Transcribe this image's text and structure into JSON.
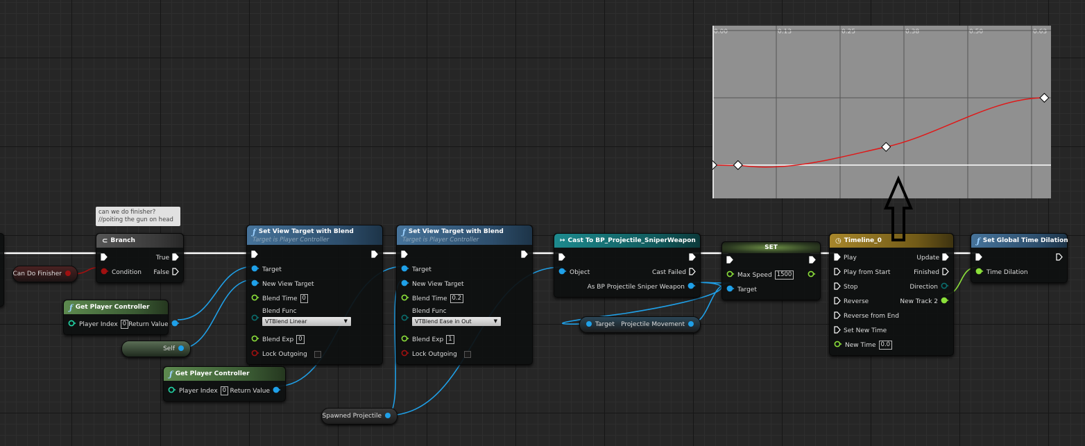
{
  "comment": {
    "lines": [
      "can we do finisher?",
      "//poiting the gun on head"
    ]
  },
  "nodes": [
    {
      "title": "Branch",
      "style": "branch",
      "icon": "branch-icon",
      "rows": [
        {
          "l": {
            "pin": "exec",
            "label": "",
            "connected": true
          },
          "r": {
            "pin": "exec",
            "label": "True",
            "connected": true
          }
        },
        {
          "l": {
            "pin": "bool",
            "label": "Condition",
            "connected": true
          },
          "r": {
            "pin": "exec",
            "label": "False",
            "connected": false
          }
        }
      ]
    },
    {
      "title": "Get Player Controller",
      "style": "pure",
      "icon": "function-icon",
      "rows": [
        {
          "l": {
            "pin": "int",
            "label": "Player Index",
            "value": "0"
          },
          "r": {
            "pin": "object",
            "label": "Return Value",
            "connected": true
          }
        }
      ]
    },
    {
      "title": "Set View Target with Blend",
      "subtitle": "Target is Player Controller",
      "style": "func",
      "icon": "function-icon",
      "rows": [
        {
          "l": {
            "pin": "exec",
            "label": "",
            "connected": true
          },
          "r": {
            "pin": "exec",
            "label": "",
            "connected": true
          }
        },
        {
          "l": {
            "pin": "object",
            "label": "Target",
            "connected": true
          }
        },
        {
          "l": {
            "pin": "object",
            "label": "New View Target",
            "connected": true
          }
        },
        {
          "l": {
            "pin": "float",
            "label": "Blend Time",
            "value": "0"
          }
        },
        {
          "l": {
            "pin": "enum",
            "label": "Blend Func",
            "dropdown": "VTBlend Linear"
          }
        },
        {
          "l": {
            "pin": "float",
            "label": "Blend Exp",
            "value": "0"
          }
        },
        {
          "l": {
            "pin": "bool",
            "label": "Lock Outgoing",
            "checkbox": false
          }
        }
      ]
    },
    {
      "title": "Get Player Controller",
      "style": "pure",
      "icon": "function-icon",
      "rows": [
        {
          "l": {
            "pin": "int",
            "label": "Player Index",
            "value": "0"
          },
          "r": {
            "pin": "object",
            "label": "Return Value",
            "connected": true
          }
        }
      ]
    },
    {
      "title": "Set View Target with Blend",
      "subtitle": "Target is Player Controller",
      "style": "func",
      "icon": "function-icon",
      "rows": [
        {
          "l": {
            "pin": "exec",
            "label": "",
            "connected": true
          },
          "r": {
            "pin": "exec",
            "label": "",
            "connected": true
          }
        },
        {
          "l": {
            "pin": "object",
            "label": "Target",
            "connected": true
          }
        },
        {
          "l": {
            "pin": "object",
            "label": "New View Target",
            "connected": true
          }
        },
        {
          "l": {
            "pin": "float",
            "label": "Blend Time",
            "value": "0.2"
          }
        },
        {
          "l": {
            "pin": "enum",
            "label": "Blend Func",
            "dropdown": "VTBlend Ease in Out"
          }
        },
        {
          "l": {
            "pin": "float",
            "label": "Blend Exp",
            "value": "1"
          }
        },
        {
          "l": {
            "pin": "bool",
            "label": "Lock Outgoing",
            "checkbox": false
          }
        }
      ]
    },
    {
      "title": "Cast To BP_Projectile_SniperWeapon",
      "style": "cast",
      "icon": "cast-icon",
      "rows": [
        {
          "l": {
            "pin": "exec",
            "label": "",
            "connected": true
          },
          "r": {
            "pin": "exec",
            "label": "",
            "connected": true
          }
        },
        {
          "l": {
            "pin": "object",
            "label": "Object",
            "connected": true
          },
          "r": {
            "pin": "exec",
            "label": "Cast Failed",
            "connected": false
          }
        },
        {
          "r": {
            "pin": "object",
            "label": "As BP Projectile Sniper Weapon",
            "connected": true
          }
        }
      ]
    },
    {
      "title": "SET",
      "style": "set",
      "icon": "",
      "rows": [
        {
          "l": {
            "pin": "exec",
            "label": "",
            "connected": true
          },
          "r": {
            "pin": "exec",
            "label": "",
            "connected": true
          }
        },
        {
          "l": {
            "pin": "float",
            "label": "Max Speed",
            "value": "1500"
          },
          "r": {
            "pin": "float",
            "label": ""
          }
        },
        {
          "l": {
            "pin": "object",
            "label": "Target",
            "connected": true
          }
        }
      ]
    },
    {
      "title": "Timeline_0",
      "style": "time",
      "icon": "clock-icon",
      "rows": [
        {
          "l": {
            "pin": "exec",
            "label": "Play",
            "connected": true
          },
          "r": {
            "pin": "exec",
            "label": "Update",
            "connected": true
          }
        },
        {
          "l": {
            "pin": "exec",
            "label": "Play from Start"
          },
          "r": {
            "pin": "exec",
            "label": "Finished"
          }
        },
        {
          "l": {
            "pin": "exec",
            "label": "Stop"
          },
          "r": {
            "pin": "enum",
            "label": "Direction"
          }
        },
        {
          "l": {
            "pin": "exec",
            "label": "Reverse"
          },
          "r": {
            "pin": "float",
            "label": "New Track 2",
            "connected": true
          }
        },
        {
          "l": {
            "pin": "exec",
            "label": "Reverse from End"
          }
        },
        {
          "l": {
            "pin": "exec",
            "label": "Set New Time"
          }
        },
        {
          "l": {
            "pin": "float",
            "label": "New Time",
            "value": "0.0"
          }
        }
      ]
    },
    {
      "title": "Set Global Time Dilation",
      "style": "func",
      "icon": "function-icon",
      "rows": [
        {
          "l": {
            "pin": "exec",
            "label": "",
            "connected": true
          },
          "r": {
            "pin": "exec",
            "label": ""
          }
        },
        {
          "l": {
            "pin": "float",
            "label": "Time Dilation",
            "connected": true
          }
        }
      ]
    }
  ],
  "variables": {
    "can_do_finisher": "Can Do Finisher",
    "self": "Self",
    "spawned_projectile": "Spawned Projectile",
    "projectile_movement": {
      "input": "Target",
      "output": "Projectile Movement"
    }
  },
  "curve": {
    "tick_labels": [
      "0.00",
      "0.13",
      "0.25",
      "0.38",
      "0.50",
      "0.63"
    ],
    "keys": [
      {
        "time": 0.0,
        "value": 0.0
      },
      {
        "time": 0.05,
        "value": 0.0
      },
      {
        "time": 0.34,
        "value": 0.27
      },
      {
        "time": 0.65,
        "value": 1.0
      }
    ],
    "curve_color": "#e01818"
  },
  "colors": {
    "exec": "#ffffff",
    "object": "#1fa0e8",
    "float": "#8be03a",
    "bool": "#a01010",
    "enum": "#0b6e6e",
    "int": "#22d6a6"
  }
}
